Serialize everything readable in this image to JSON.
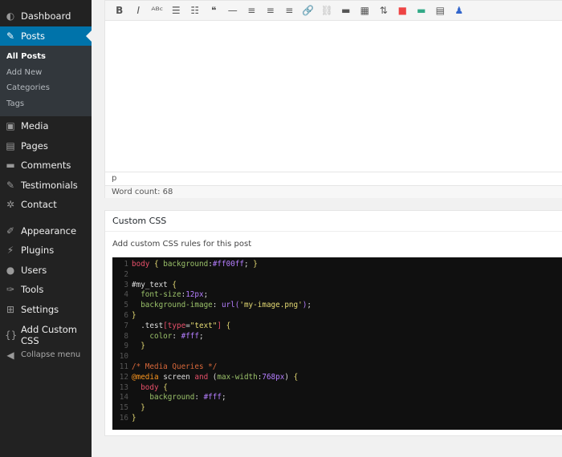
{
  "sidebar": {
    "items": [
      {
        "label": "Dashboard",
        "icon": "dashboard-icon"
      },
      {
        "label": "Posts",
        "icon": "pin-icon",
        "active": true
      },
      {
        "label": "Media",
        "icon": "media-icon"
      },
      {
        "label": "Pages",
        "icon": "pages-icon"
      },
      {
        "label": "Comments",
        "icon": "comment-icon"
      },
      {
        "label": "Testimonials",
        "icon": "pin-icon"
      },
      {
        "label": "Contact",
        "icon": "gear-icon"
      },
      {
        "label": "Appearance",
        "icon": "brush-icon"
      },
      {
        "label": "Plugins",
        "icon": "plug-icon"
      },
      {
        "label": "Users",
        "icon": "user-icon"
      },
      {
        "label": "Tools",
        "icon": "wrench-icon"
      },
      {
        "label": "Settings",
        "icon": "settings-icon"
      },
      {
        "label": "Add Custom CSS",
        "icon": "braces-icon"
      },
      {
        "label": "Collapse menu",
        "icon": "collapse-icon"
      }
    ],
    "submenu": [
      "All Posts",
      "Add New",
      "Categories",
      "Tags"
    ]
  },
  "editor": {
    "toolbar": [
      "bold",
      "italic",
      "strikethrough",
      "bullet-list",
      "numbered-list",
      "blockquote",
      "horizontal-rule",
      "align-left",
      "align-center",
      "align-right",
      "link",
      "unlink",
      "read-more",
      "toolbar-toggle",
      "insert",
      "color-grid",
      "bar",
      "list-box",
      "user"
    ],
    "path": "p",
    "word_count": "Word count: 68"
  },
  "custom_css": {
    "title": "Custom CSS",
    "description": "Add custom CSS rules for this post",
    "lines": [
      [
        [
          "s",
          "body"
        ],
        [
          "w",
          " "
        ],
        [
          "b",
          "{"
        ],
        [
          "w",
          " "
        ],
        [
          "p",
          "background"
        ],
        [
          "w",
          ":"
        ],
        [
          "v",
          "#ff00ff"
        ],
        [
          "w",
          "; "
        ],
        [
          "b",
          "}"
        ]
      ],
      [],
      [
        [
          "w",
          "#my_text "
        ],
        [
          "b",
          "{"
        ]
      ],
      [
        [
          "w",
          "  "
        ],
        [
          "p",
          "font-size"
        ],
        [
          "w",
          ":"
        ],
        [
          "v",
          "12px"
        ],
        [
          "w",
          ";"
        ]
      ],
      [
        [
          "w",
          "  "
        ],
        [
          "p",
          "background-image"
        ],
        [
          "w",
          ": "
        ],
        [
          "v",
          "url("
        ],
        [
          "st",
          "'my-image.png'"
        ],
        [
          "v",
          ")"
        ],
        [
          "w",
          ";"
        ]
      ],
      [
        [
          "b",
          "}"
        ]
      ],
      [
        [
          "w",
          "  .test"
        ],
        [
          "s",
          "["
        ],
        [
          "s",
          "type"
        ],
        [
          "w",
          "="
        ],
        [
          "st",
          "\"text\""
        ],
        [
          "s",
          "]"
        ],
        [
          "w",
          " "
        ],
        [
          "b",
          "{"
        ]
      ],
      [
        [
          "w",
          "    "
        ],
        [
          "p",
          "color"
        ],
        [
          "w",
          ": "
        ],
        [
          "v",
          "#fff"
        ],
        [
          "w",
          ";"
        ]
      ],
      [
        [
          "w",
          "  "
        ],
        [
          "b",
          "}"
        ]
      ],
      [],
      [
        [
          "c",
          "/* Media Queries */"
        ]
      ],
      [
        [
          "k",
          "@media"
        ],
        [
          "w",
          " screen "
        ],
        [
          "s",
          "and"
        ],
        [
          "w",
          " ("
        ],
        [
          "p",
          "max-width"
        ],
        [
          "w",
          ":"
        ],
        [
          "v",
          "768px"
        ],
        [
          "w",
          ") "
        ],
        [
          "b",
          "{"
        ]
      ],
      [
        [
          "w",
          "  "
        ],
        [
          "s",
          "body"
        ],
        [
          "w",
          " "
        ],
        [
          "b",
          "{"
        ]
      ],
      [
        [
          "w",
          "    "
        ],
        [
          "p",
          "background"
        ],
        [
          "w",
          ": "
        ],
        [
          "v",
          "#fff"
        ],
        [
          "w",
          ";"
        ]
      ],
      [
        [
          "w",
          "  "
        ],
        [
          "b",
          "}"
        ]
      ],
      [
        [
          "b",
          "}"
        ]
      ]
    ]
  }
}
